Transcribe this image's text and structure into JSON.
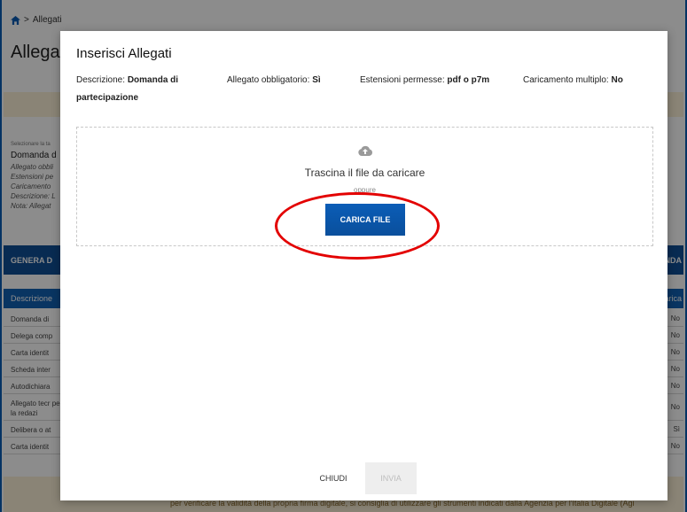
{
  "background": {
    "breadcrumb": "Allegati",
    "page_title": "Allega",
    "side": {
      "hint": "Selezionare la ta",
      "name": "Domanda d",
      "lines": [
        "Allegato obbli",
        "Estensioni pe",
        "Caricamento",
        "Descrizione: L",
        "Nota: Allegat"
      ]
    },
    "blue_bar": {
      "left": "GENERA D",
      "right": "ANDA"
    },
    "table_head": {
      "left": "Descrizione",
      "right": "Carica"
    },
    "rows": [
      {
        "left": "Domanda di",
        "right": "No"
      },
      {
        "left": "Delega comp",
        "right": "No"
      },
      {
        "left": "Carta identit",
        "right": "No"
      },
      {
        "left": "Scheda inter",
        "right": "No"
      },
      {
        "left": "Autodichiara",
        "right": "No"
      },
      {
        "left": "Allegato tecr per la redazi",
        "right": "No"
      },
      {
        "left": "Delibera o at",
        "right": "Sì"
      },
      {
        "left": "Carta identit",
        "right": "No"
      }
    ],
    "footer_note": "per verificare la validità della propria firma digitale, si consiglia di utilizzare gli strumenti indicati dalla Agenzia per l'Italia Digitale (Agi"
  },
  "modal": {
    "title": "Inserisci Allegati",
    "meta": {
      "description_label": "Descrizione:",
      "description_value": "Domanda di partecipazione",
      "mandatory_label": "Allegato obbligatorio:",
      "mandatory_value": "Sì",
      "extensions_label": "Estensioni permesse:",
      "extensions_value": "pdf o p7m",
      "multiple_label": "Caricamento multiplo:",
      "multiple_value": "No"
    },
    "dropzone": {
      "icon": "cloud-upload-icon",
      "text": "Trascina il file da caricare",
      "or": "oppure",
      "button": "CARICA FILE"
    },
    "close_button": "CHIUDI",
    "send_button": "INVIA"
  },
  "colors": {
    "primary": "#0a5bb5",
    "band": "#fcf0d8",
    "highlight": "#e30000"
  }
}
